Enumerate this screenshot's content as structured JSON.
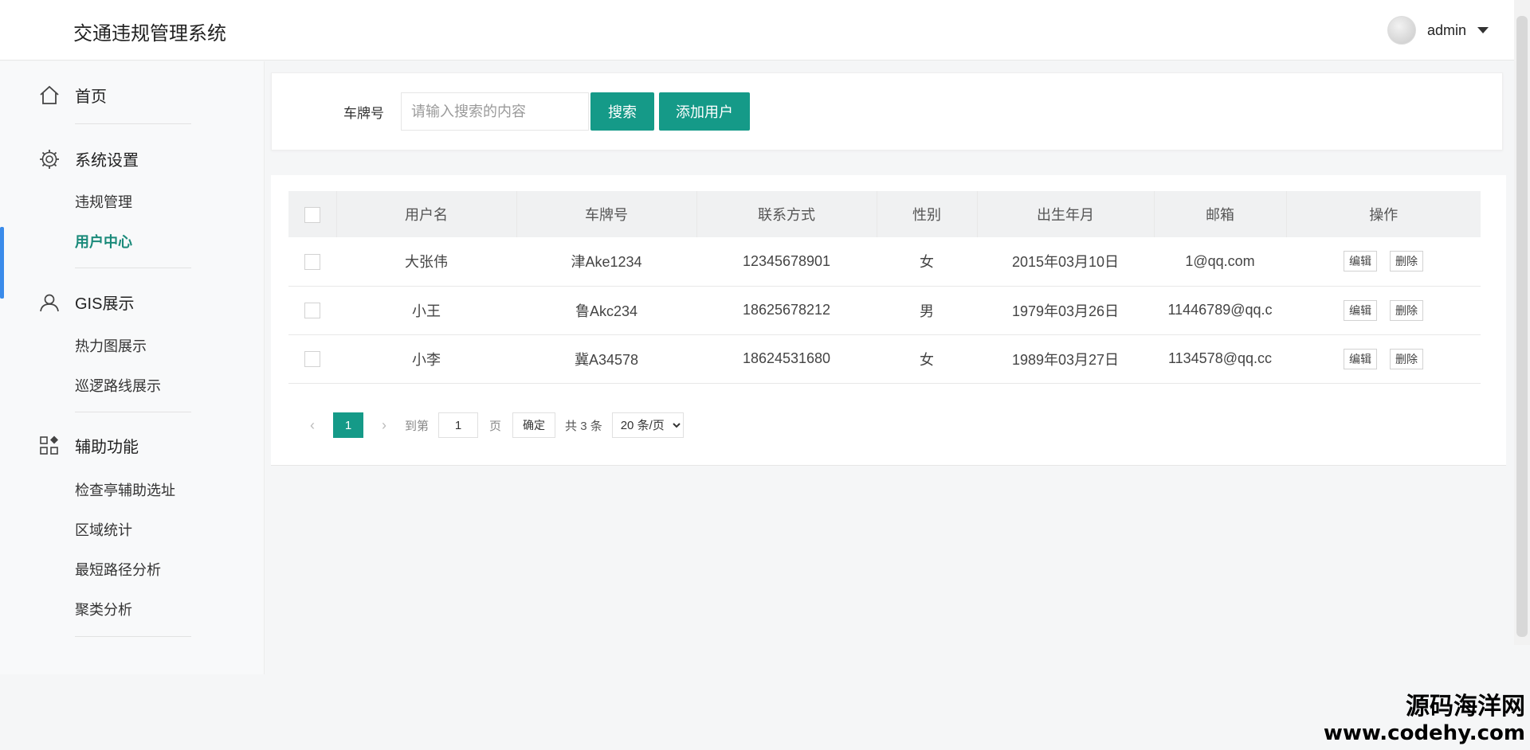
{
  "header": {
    "title": "交通违规管理系统",
    "username": "admin"
  },
  "sidebar": {
    "home": "首页",
    "groups": [
      {
        "title": "系统设置",
        "items": [
          "违规管理",
          "用户中心"
        ]
      },
      {
        "title": "GIS展示",
        "items": [
          "热力图展示",
          "巡逻路线展示"
        ]
      },
      {
        "title": "辅助功能",
        "items": [
          "检查亭辅助选址",
          "区域统计",
          "最短路径分析",
          "聚类分析"
        ]
      }
    ],
    "active_item": "用户中心"
  },
  "search": {
    "label": "车牌号",
    "placeholder": "请输入搜索的内容",
    "search_button": "搜索",
    "add_button": "添加用户"
  },
  "table": {
    "columns": [
      "用户名",
      "车牌号",
      "联系方式",
      "性别",
      "出生年月",
      "邮箱",
      "操作"
    ],
    "rows": [
      {
        "username": "大张伟",
        "plate": "津Ake1234",
        "phone": "12345678901",
        "gender": "女",
        "birth": "2015年03月10日",
        "email": "1@qq.com"
      },
      {
        "username": "小王",
        "plate": "鲁Akc234",
        "phone": "18625678212",
        "gender": "男",
        "birth": "1979年03月26日",
        "email": "11446789@qq.c"
      },
      {
        "username": "小李",
        "plate": "冀A34578",
        "phone": "18624531680",
        "gender": "女",
        "birth": "1989年03月27日",
        "email": "1134578@qq.cc"
      }
    ],
    "edit_label": "编辑",
    "delete_label": "删除"
  },
  "pager": {
    "current_page": "1",
    "goto_label": "到第",
    "goto_value": "1",
    "page_unit": "页",
    "confirm_label": "确定",
    "total_label": "共 3 条",
    "page_size": "20 条/页"
  },
  "watermark": {
    "cn": "源码海洋网",
    "url": "www.codehy.com"
  },
  "colors": {
    "primary": "#159a88",
    "active_text": "#1a8a7a",
    "active_bar": "#3a8bea"
  }
}
